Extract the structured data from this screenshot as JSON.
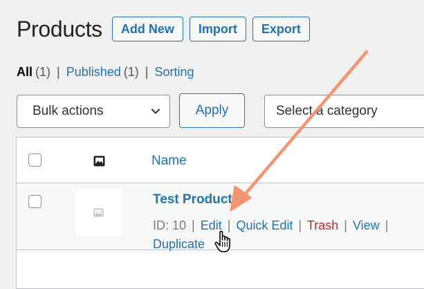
{
  "header": {
    "title": "Products",
    "buttons": [
      "Add New",
      "Import",
      "Export"
    ]
  },
  "filters": {
    "all_label": "All",
    "all_count": "(1)",
    "published_label": "Published",
    "published_count": "(1)",
    "sorting_label": "Sorting",
    "separator": "|"
  },
  "toolbar": {
    "bulk_actions": "Bulk actions",
    "apply_label": "Apply",
    "category_select": "Select a category"
  },
  "table": {
    "column_name": "Name",
    "row": {
      "name": "Test Product",
      "id_text": "ID: 10",
      "actions": {
        "edit": "Edit",
        "quick_edit": "Quick Edit",
        "trash": "Trash",
        "view": "View",
        "duplicate": "Duplicate"
      }
    }
  },
  "colors": {
    "link": "#2271b1",
    "trash": "#b32d2e",
    "arrow": "#f39470",
    "background": "#f0f0f1"
  }
}
